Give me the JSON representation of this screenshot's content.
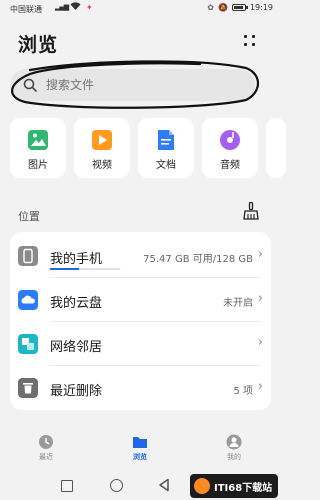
{
  "status_bar": {
    "carrier": "中国联通",
    "time": "19:19"
  },
  "header": {
    "title": "浏览"
  },
  "search": {
    "placeholder": "搜索文件"
  },
  "categories": [
    {
      "label": "图片",
      "icon": "image-icon",
      "color": "#2eb872"
    },
    {
      "label": "视频",
      "icon": "video-icon",
      "color": "#ff9a1f"
    },
    {
      "label": "文档",
      "icon": "document-icon",
      "color": "#2f7df6"
    },
    {
      "label": "音频",
      "icon": "audio-icon",
      "color": "#a25ff0"
    }
  ],
  "locations": {
    "title": "位置",
    "items": [
      {
        "label": "我的手机",
        "value": "75.47 GB 可用/128 GB",
        "icon": "phone-icon",
        "color": "#8a8a8a",
        "usage_fraction": 0.41
      },
      {
        "label": "我的云盘",
        "value": "未开启",
        "icon": "cloud-icon",
        "color": "#2f7df6"
      },
      {
        "label": "网络邻居",
        "value": "",
        "icon": "network-icon",
        "color": "#1fb5c8"
      },
      {
        "label": "最近删除",
        "value": "5 项",
        "icon": "trash-icon",
        "color": "#6e6e6e"
      }
    ]
  },
  "tabs": [
    {
      "label": "最近",
      "icon": "clock-icon"
    },
    {
      "label": "浏览",
      "icon": "folder-icon",
      "active": true
    },
    {
      "label": "我的",
      "icon": "person-icon"
    }
  ],
  "watermark": {
    "text": "ITI68下载站"
  },
  "colors": {
    "accent": "#1e68e8",
    "background": "#f2f2f2"
  }
}
